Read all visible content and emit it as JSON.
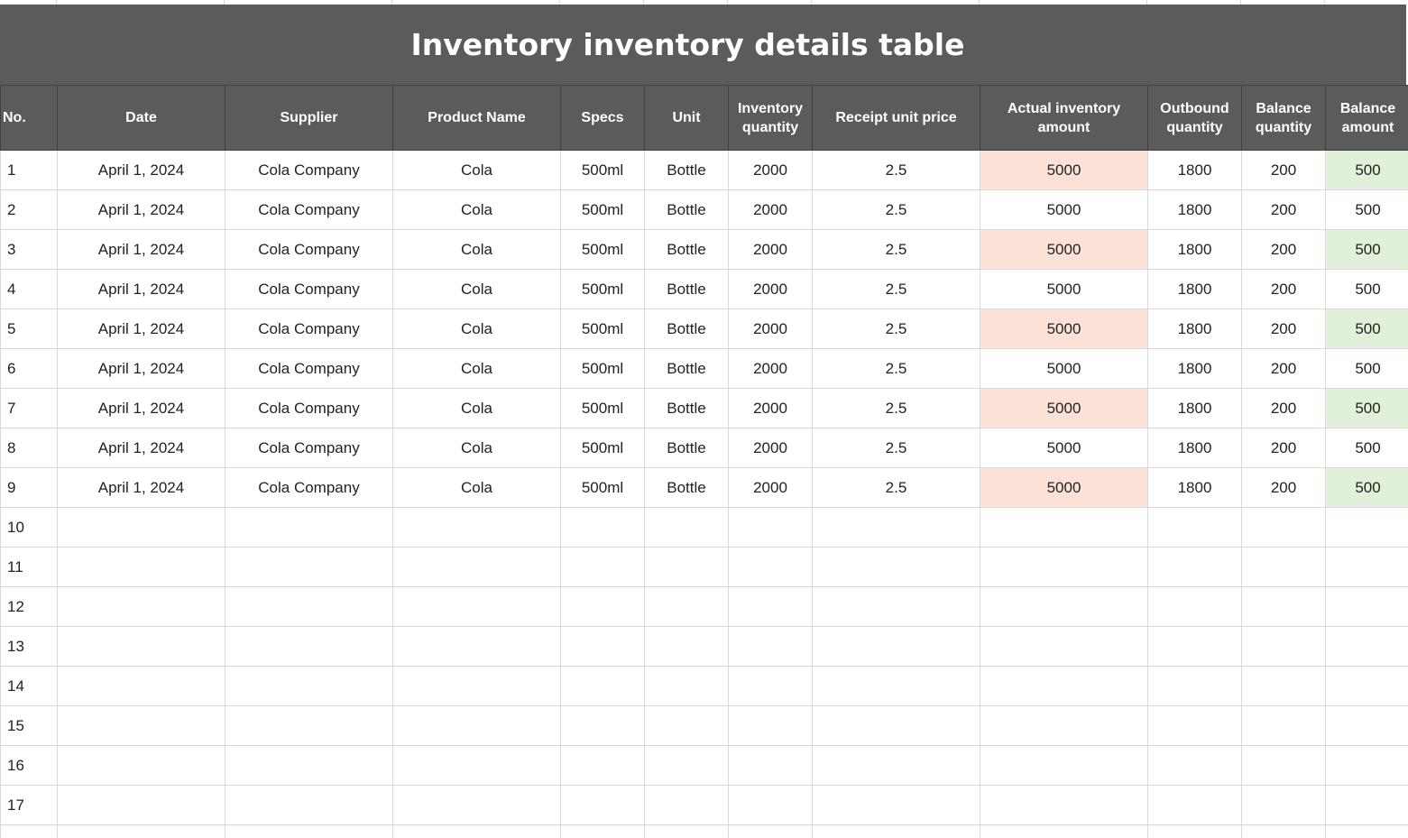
{
  "sheet": {
    "title": "Inventory inventory details table",
    "colors": {
      "header_bg": "#5b5b5b",
      "header_text": "#ffffff",
      "actual_amount_highlight": "#fce1d6",
      "balance_amount_highlight": "#e1f0d8",
      "grid_line": "#d9d9d9"
    },
    "columns": [
      "No.",
      "Date",
      "Supplier",
      "Product Name",
      "Specs",
      "Unit",
      "Inventory quantity",
      "Receipt unit price",
      "Actual inventory amount",
      "Outbound quantity",
      "Balance quantity",
      "Balance amount"
    ],
    "rows": [
      {
        "no": "1",
        "date": "April 1, 2024",
        "supplier": "Cola Company",
        "product": "Cola",
        "specs": "500ml",
        "unit": "Bottle",
        "inv_qty": "2000",
        "unit_price": "2.5",
        "actual_amount": "5000",
        "outbound_qty": "1800",
        "balance_qty": "200",
        "balance_amount": "500",
        "highlight": true
      },
      {
        "no": "2",
        "date": "April 1, 2024",
        "supplier": "Cola Company",
        "product": "Cola",
        "specs": "500ml",
        "unit": "Bottle",
        "inv_qty": "2000",
        "unit_price": "2.5",
        "actual_amount": "5000",
        "outbound_qty": "1800",
        "balance_qty": "200",
        "balance_amount": "500",
        "highlight": false
      },
      {
        "no": "3",
        "date": "April 1, 2024",
        "supplier": "Cola Company",
        "product": "Cola",
        "specs": "500ml",
        "unit": "Bottle",
        "inv_qty": "2000",
        "unit_price": "2.5",
        "actual_amount": "5000",
        "outbound_qty": "1800",
        "balance_qty": "200",
        "balance_amount": "500",
        "highlight": true
      },
      {
        "no": "4",
        "date": "April 1, 2024",
        "supplier": "Cola Company",
        "product": "Cola",
        "specs": "500ml",
        "unit": "Bottle",
        "inv_qty": "2000",
        "unit_price": "2.5",
        "actual_amount": "5000",
        "outbound_qty": "1800",
        "balance_qty": "200",
        "balance_amount": "500",
        "highlight": false
      },
      {
        "no": "5",
        "date": "April 1, 2024",
        "supplier": "Cola Company",
        "product": "Cola",
        "specs": "500ml",
        "unit": "Bottle",
        "inv_qty": "2000",
        "unit_price": "2.5",
        "actual_amount": "5000",
        "outbound_qty": "1800",
        "balance_qty": "200",
        "balance_amount": "500",
        "highlight": true
      },
      {
        "no": "6",
        "date": "April 1, 2024",
        "supplier": "Cola Company",
        "product": "Cola",
        "specs": "500ml",
        "unit": "Bottle",
        "inv_qty": "2000",
        "unit_price": "2.5",
        "actual_amount": "5000",
        "outbound_qty": "1800",
        "balance_qty": "200",
        "balance_amount": "500",
        "highlight": false
      },
      {
        "no": "7",
        "date": "April 1, 2024",
        "supplier": "Cola Company",
        "product": "Cola",
        "specs": "500ml",
        "unit": "Bottle",
        "inv_qty": "2000",
        "unit_price": "2.5",
        "actual_amount": "5000",
        "outbound_qty": "1800",
        "balance_qty": "200",
        "balance_amount": "500",
        "highlight": true
      },
      {
        "no": "8",
        "date": "April 1, 2024",
        "supplier": "Cola Company",
        "product": "Cola",
        "specs": "500ml",
        "unit": "Bottle",
        "inv_qty": "2000",
        "unit_price": "2.5",
        "actual_amount": "5000",
        "outbound_qty": "1800",
        "balance_qty": "200",
        "balance_amount": "500",
        "highlight": false
      },
      {
        "no": "9",
        "date": "April 1, 2024",
        "supplier": "Cola Company",
        "product": "Cola",
        "specs": "500ml",
        "unit": "Bottle",
        "inv_qty": "2000",
        "unit_price": "2.5",
        "actual_amount": "5000",
        "outbound_qty": "1800",
        "balance_qty": "200",
        "balance_amount": "500",
        "highlight": true
      }
    ],
    "empty_row_numbers": [
      "10",
      "11",
      "12",
      "13",
      "14",
      "15",
      "16",
      "17",
      ""
    ]
  }
}
